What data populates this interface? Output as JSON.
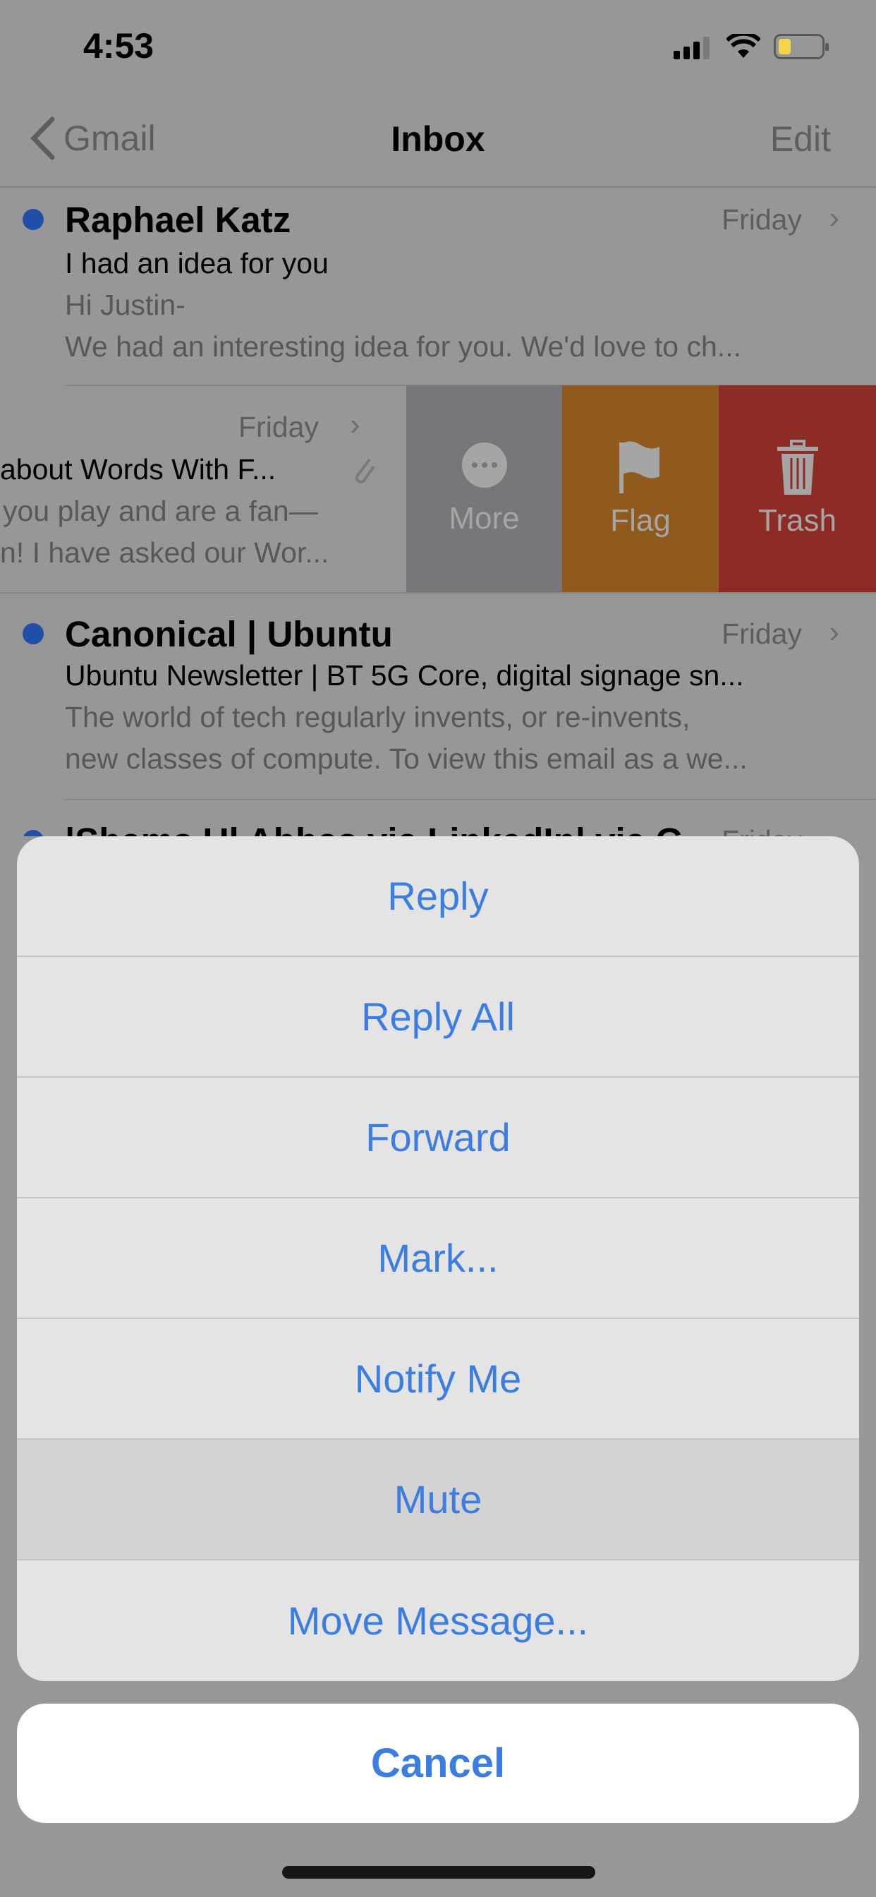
{
  "status_bar": {
    "time": "4:53",
    "battery_color": "#f5d547"
  },
  "nav": {
    "back_label": "Gmail",
    "title": "Inbox",
    "edit_label": "Edit"
  },
  "emails": [
    {
      "sender": "Raphael Katz",
      "date": "Friday",
      "subject": "I had an idea for you",
      "preview_1": "Hi Justin-",
      "preview_2": "We had an interesting idea for you. We'd love to ch...",
      "unread": true
    },
    {
      "date": "Friday",
      "subject": "about Words With F...",
      "preview_1": "you play and are a fan—",
      "preview_2": "n! I have asked our Wor...",
      "attachment": true
    },
    {
      "sender": "Canonical | Ubuntu",
      "date": "Friday",
      "subject": "Ubuntu Newsletter | BT 5G Core, digital signage sn...",
      "preview_1": "The world of tech regularly invents, or re-invents,",
      "preview_2": "new classes of compute. To view this email as a we...",
      "unread": true
    },
    {
      "sender": "|Shams Ul Abbas via LinkedIn| via G...",
      "date": "Friday",
      "unread": true
    }
  ],
  "swipe_actions": [
    {
      "label": "More",
      "icon": "more-icon",
      "color": "#77777b"
    },
    {
      "label": "Flag",
      "icon": "flag-icon",
      "color": "#8f5a1c"
    },
    {
      "label": "Trash",
      "icon": "trash-icon",
      "color": "#8c2c25"
    }
  ],
  "action_sheet": {
    "items": [
      "Reply",
      "Reply All",
      "Forward",
      "Mark...",
      "Notify Me",
      "Mute",
      "Move Message..."
    ],
    "pressed_item": "Mute",
    "cancel_label": "Cancel",
    "accent_color": "#3b7de0"
  }
}
